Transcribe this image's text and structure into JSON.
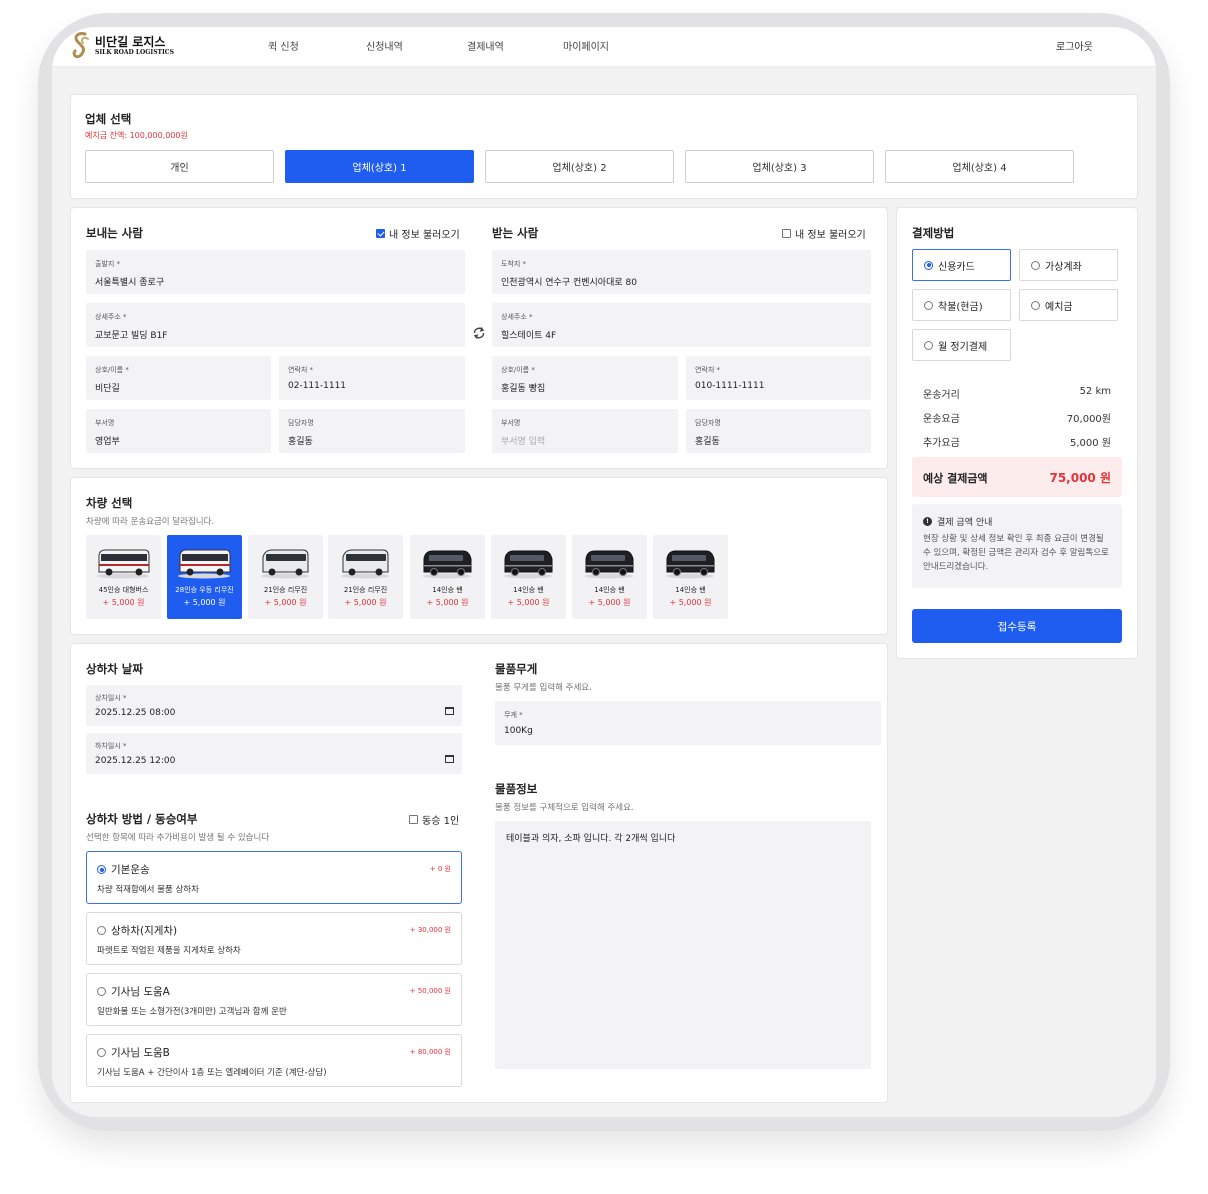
{
  "brand": {
    "name_ko": "비단길 로지스",
    "name_en": "SILK ROAD LOGISTICS"
  },
  "nav": {
    "items": [
      "퀵 신청",
      "신청내역",
      "결제내역",
      "마이페이지"
    ],
    "logout": "로그아웃"
  },
  "company": {
    "title": "업체 선택",
    "balance": "예치금 잔액: 100,000,000원",
    "options": [
      "개인",
      "업체(상호) 1",
      "업체(상호) 2",
      "업체(상호) 3",
      "업체(상호) 4"
    ],
    "selected": "업체(상호) 1"
  },
  "sender": {
    "title": "보내는 사람",
    "load_info": "내 정보 불러오기",
    "load_checked": true,
    "fields": [
      {
        "label": "출발지 *",
        "value": "서울특별시 종로구",
        "placeholder": ""
      },
      {
        "label": "상세주소 *",
        "value": "교보문고 빌딩 B1F",
        "placeholder": ""
      },
      {
        "label": "상호/이름 *",
        "value": "비단길",
        "placeholder": ""
      },
      {
        "label": "연락처 *",
        "value": "02-111-1111",
        "placeholder": ""
      },
      {
        "label": "부서명",
        "value": "영업부",
        "placeholder": ""
      },
      {
        "label": "담당자명",
        "value": "홍길동",
        "placeholder": ""
      }
    ]
  },
  "receiver": {
    "title": "받는 사람",
    "load_info": "내 정보 불러오기",
    "load_checked": false,
    "fields": [
      {
        "label": "도착지 *",
        "value": "인천광역시 연수구 컨벤시아대로 80",
        "placeholder": ""
      },
      {
        "label": "상세주소 *",
        "value": "힐스테이트 4F",
        "placeholder": ""
      },
      {
        "label": "상호/이름 *",
        "value": "홍길동 빵집",
        "placeholder": ""
      },
      {
        "label": "연락처 *",
        "value": "010-1111-1111",
        "placeholder": ""
      },
      {
        "label": "부서명",
        "value": "",
        "placeholder": "부서명 입력"
      },
      {
        "label": "담당자명",
        "value": "홍길동",
        "placeholder": ""
      }
    ]
  },
  "vehicle": {
    "title": "차량 선택",
    "subtitle": "차량에 따라 운송요금이 달라집니다.",
    "items": [
      {
        "name": "45인승 대형버스",
        "price": "+ 5,000 원",
        "icon": "bus-icon"
      },
      {
        "name": "28인승 우등 리무진",
        "price": "+ 5,000 원",
        "icon": "bus-icon"
      },
      {
        "name": "21인승 리무진",
        "price": "+ 5,000 원",
        "icon": "minibus-icon"
      },
      {
        "name": "21인승 리무진",
        "price": "+ 5,000 원",
        "icon": "minibus-icon"
      },
      {
        "name": "14인승 밴",
        "price": "+ 5,000 원",
        "icon": "van-icon"
      },
      {
        "name": "14인승 밴",
        "price": "+ 5,000 원",
        "icon": "van-icon"
      },
      {
        "name": "14인승 밴",
        "price": "+ 5,000 원",
        "icon": "van-icon"
      },
      {
        "name": "14인승 밴",
        "price": "+ 5,000 원",
        "icon": "van-icon"
      }
    ],
    "selected_index": 1
  },
  "schedule": {
    "title": "상하차 날짜",
    "load_label": "상차일시 *",
    "load_value": "2025.12.25 08:00",
    "unload_label": "하차일시 *",
    "unload_value": "2025.12.25 12:00"
  },
  "method": {
    "title": "상하차 방법 / 동승여부",
    "subtitle": "선택한 항목에 따라 추가비용이 발생 될 수 있습니다",
    "ride_along": "동승 1인",
    "ride_checked": false,
    "options": [
      {
        "name": "기본운송",
        "price": "+ 0 원",
        "desc": "차량 적재함에서 물품 상하차"
      },
      {
        "name": "상하차(지게차)",
        "price": "+ 30,000 원",
        "desc": "파렛트로 작업된 제품을 지게차로 상하차"
      },
      {
        "name": "기사님 도움A",
        "price": "+ 50,000 원",
        "desc": "일반화물 또는 소형가전(3개미만) 고객님과 함께 운반"
      },
      {
        "name": "기사님 도움B",
        "price": "+ 80,000 원",
        "desc": "기사님 도움A + 간단이사 1층 또는 엘레베이터 기준 (계단-상담)"
      }
    ],
    "selected_index": 0
  },
  "weight": {
    "title": "물품무게",
    "subtitle": "물품 무게를 입력해 주세요.",
    "label": "무게 *",
    "value": "100Kg"
  },
  "goods": {
    "title": "물품정보",
    "subtitle": "물품 정보를 구체적으로 입력해 주세요.",
    "value": "테이블과 의자, 소파 입니다. 각 2개씩 입니다"
  },
  "payment": {
    "title": "결제방법",
    "methods": [
      "신용카드",
      "가상계좌",
      "착불(현금)",
      "예치금",
      "월 정기결제"
    ],
    "selected": "신용카드",
    "summary": [
      {
        "label": "운송거리",
        "value": "52 km"
      },
      {
        "label": "운송요금",
        "value": "70,000원"
      },
      {
        "label": "추가요금",
        "value": "5,000 원"
      }
    ],
    "total_label": "예상 결제금액",
    "total_value": "75,000 원",
    "notice_title": "결제 금액 안내",
    "notice_body": "현장 상황 및 상세 정보 확인 후 최종 요금이 변경될 수 있으며, 확정된 금액은 관리자 검수 후 알림톡으로 안내드리겠습니다.",
    "submit": "접수등록"
  },
  "colors": {
    "accent": "#1f5df0",
    "price_red": "#e5333a",
    "field_bg": "#f3f3f5",
    "total_bg": "#fdecec"
  }
}
